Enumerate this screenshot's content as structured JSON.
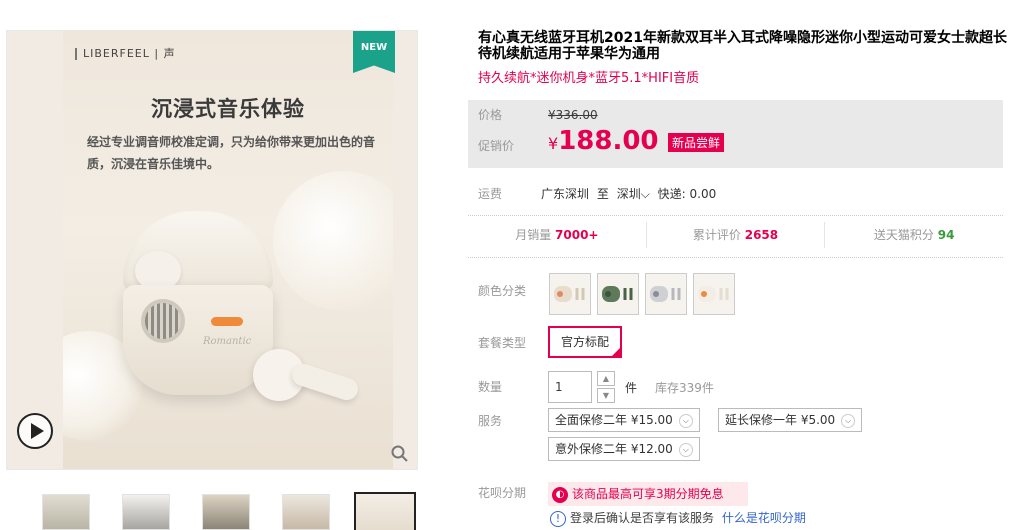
{
  "gallery": {
    "brand": "LIBERFEEL | 声",
    "new_badge": "NEW",
    "headline": "沉浸式音乐体验",
    "subtext": "经过专业调音师校准定调，只为给你带来更加出色的音质，沉浸在音乐佳境中。",
    "case_text": "Romantic",
    "thumb_count": 5
  },
  "product": {
    "title": "有心真无线蓝牙耳机2021年新款双耳半入耳式降噪隐形迷你小型运动可爱女士款超长待机续航适用于苹果华为通用",
    "subtitle": "持久续航*迷你机身*蓝牙5.1*HIFI音质"
  },
  "price": {
    "label": "价格",
    "original": "¥336.00",
    "sale_label": "促销价",
    "currency": "¥",
    "sale_value": "188.00",
    "promo_tag": "新品尝鲜"
  },
  "shipping": {
    "label": "运费",
    "from": "广东深圳",
    "to_word": "至",
    "to": "深圳",
    "method": "快递: 0.00"
  },
  "stats": {
    "sales_label": "月销量",
    "sales_value": "7000+",
    "reviews_label": "累计评价",
    "reviews_value": "2658",
    "points_label": "送天猫积分",
    "points_value": "94"
  },
  "options": {
    "color_label": "颜色分类",
    "package_label": "套餐类型",
    "package_selected": "官方标配",
    "qty_label": "数量",
    "qty_value": "1",
    "qty_unit": "件",
    "stock": "库存339件",
    "service_label": "服务",
    "services": [
      "全面保修二年 ¥15.00",
      "延长保修一年 ¥5.00",
      "意外保修二年 ¥12.00"
    ],
    "installment_label": "花呗分期",
    "installment_promo": "该商品最高可享3期分期免息",
    "login_note": "登录后确认是否享有该服务",
    "login_link": "什么是花呗分期"
  },
  "colors": {
    "accent": "#e5004f",
    "badge": "#1aa38a",
    "price_bg": "#e9e9e9"
  }
}
